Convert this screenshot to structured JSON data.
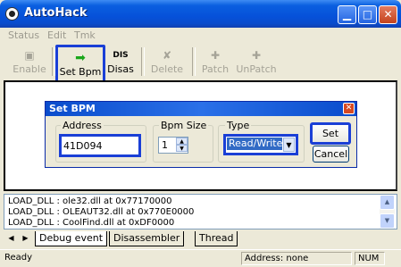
{
  "window": {
    "title": "AutoHack"
  },
  "menu": [
    "Status",
    "Edit",
    "Tmk"
  ],
  "toolbar": {
    "enable": "Enable",
    "set_bpm": "Set Bpm",
    "disas_icon_text": "DIS",
    "disas": "Disas",
    "delete": "Delete",
    "patch": "Patch",
    "unpatch": "UnPatch"
  },
  "dialog": {
    "title": "Set BPM",
    "address_label": "Address",
    "address_value": "41D094",
    "bpm_size_label": "Bpm Size",
    "bpm_size_value": "1",
    "type_label": "Type",
    "type_value": "Read/Write",
    "set_button": "Set",
    "cancel_button": "Cancel"
  },
  "log": [
    "LOAD_DLL : ole32.dll at 0x77170000",
    "LOAD_DLL : OLEAUT32.dll at 0x770E0000",
    "LOAD_DLL : CoolFind.dll at 0xDF0000"
  ],
  "tabs": [
    "Debug event",
    "Disassembler",
    "Thread"
  ],
  "status": {
    "left": "Ready",
    "address": "Address: none",
    "num": "NUM"
  }
}
